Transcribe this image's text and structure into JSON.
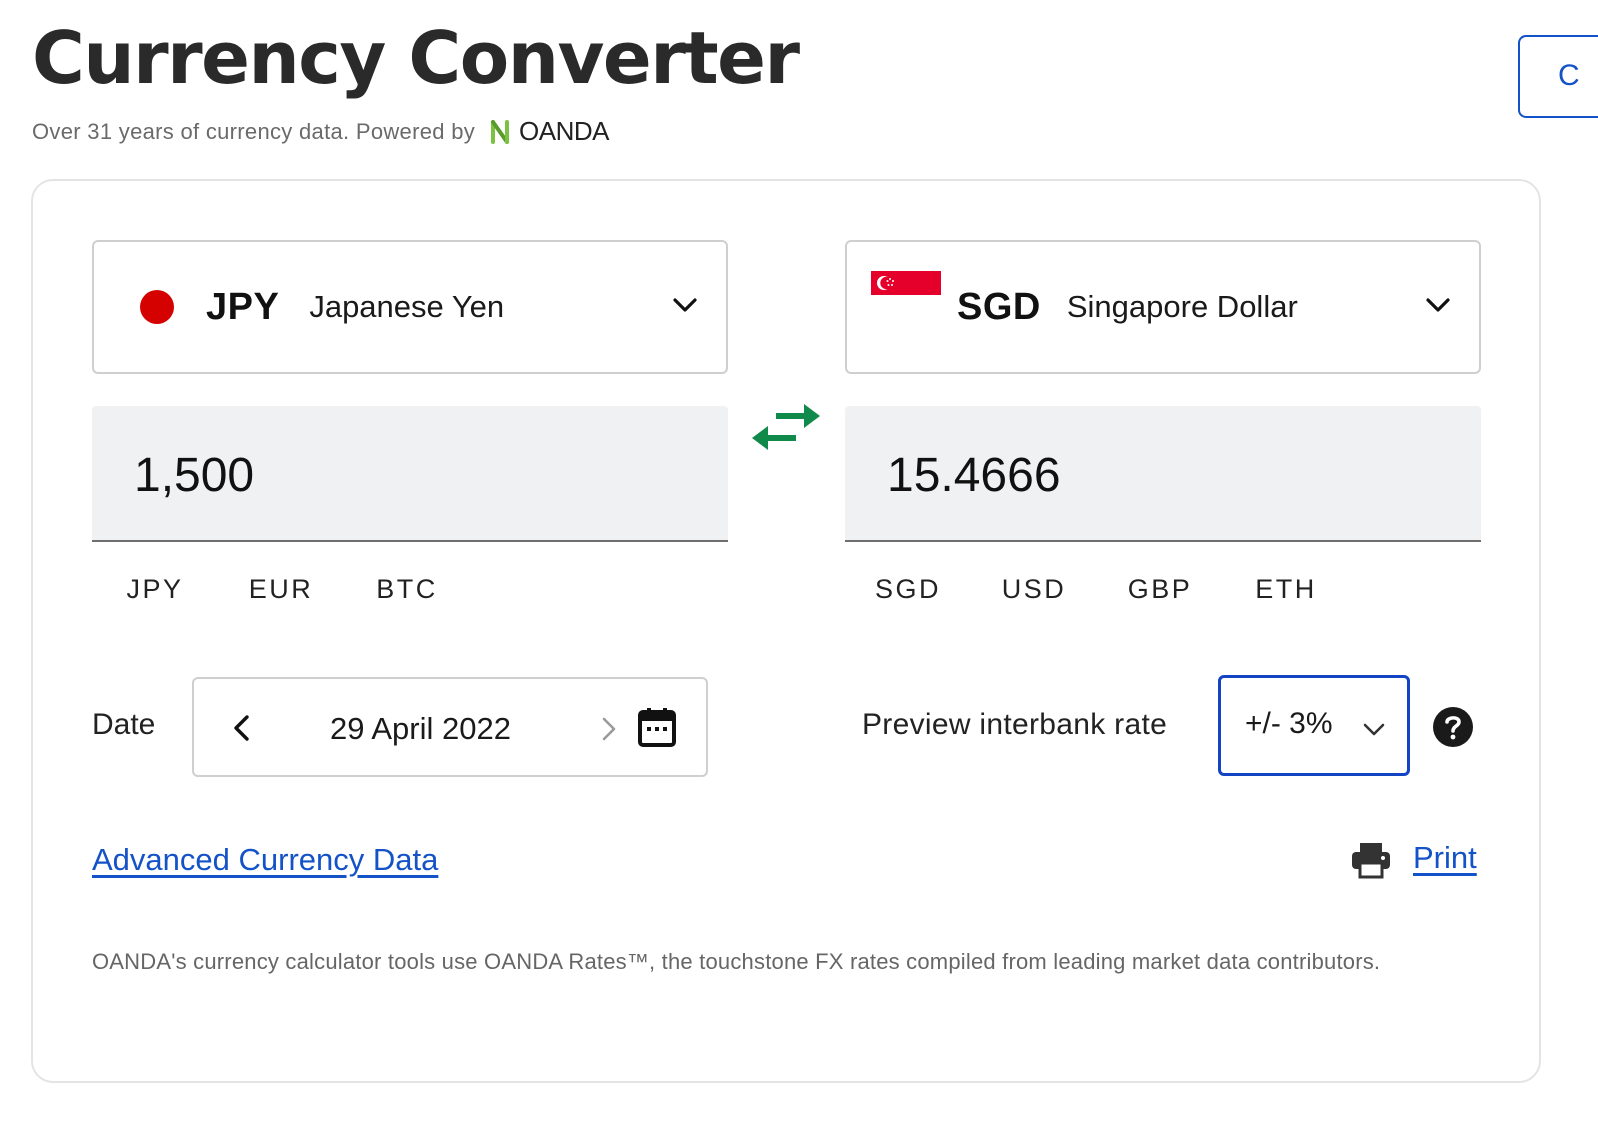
{
  "header": {
    "title": "Currency Converter",
    "subtitle": "Over 31 years of currency data. Powered by",
    "brand_logo_text": "OANDA",
    "right_button_label": "C"
  },
  "converter": {
    "from": {
      "code": "JPY",
      "name": "Japanese Yen",
      "flag": "japan-flag",
      "amount": "1,500",
      "quick_currencies": [
        "JPY",
        "EUR",
        "BTC"
      ]
    },
    "to": {
      "code": "SGD",
      "name": "Singapore Dollar",
      "flag": "singapore-flag",
      "amount": "15.4666",
      "quick_currencies": [
        "SGD",
        "USD",
        "GBP",
        "ETH"
      ]
    },
    "swap_icon": "swap-arrows-icon"
  },
  "date": {
    "label": "Date",
    "value": "29 April 2022"
  },
  "interbank": {
    "label": "Preview interbank rate",
    "selected": "+/- 3%"
  },
  "links": {
    "advanced": "Advanced Currency Data",
    "print": "Print"
  },
  "disclaimer": "OANDA's currency calculator tools use OANDA Rates™, the touchstone FX rates compiled from leading market data contributors.",
  "colors": {
    "link_blue": "#1452c8",
    "focus_blue": "#1344c4",
    "swap_green": "#0f8a4a",
    "oanda_green": "#7cc242",
    "japan_red": "#d50000",
    "singapore_red": "#e4002b"
  }
}
